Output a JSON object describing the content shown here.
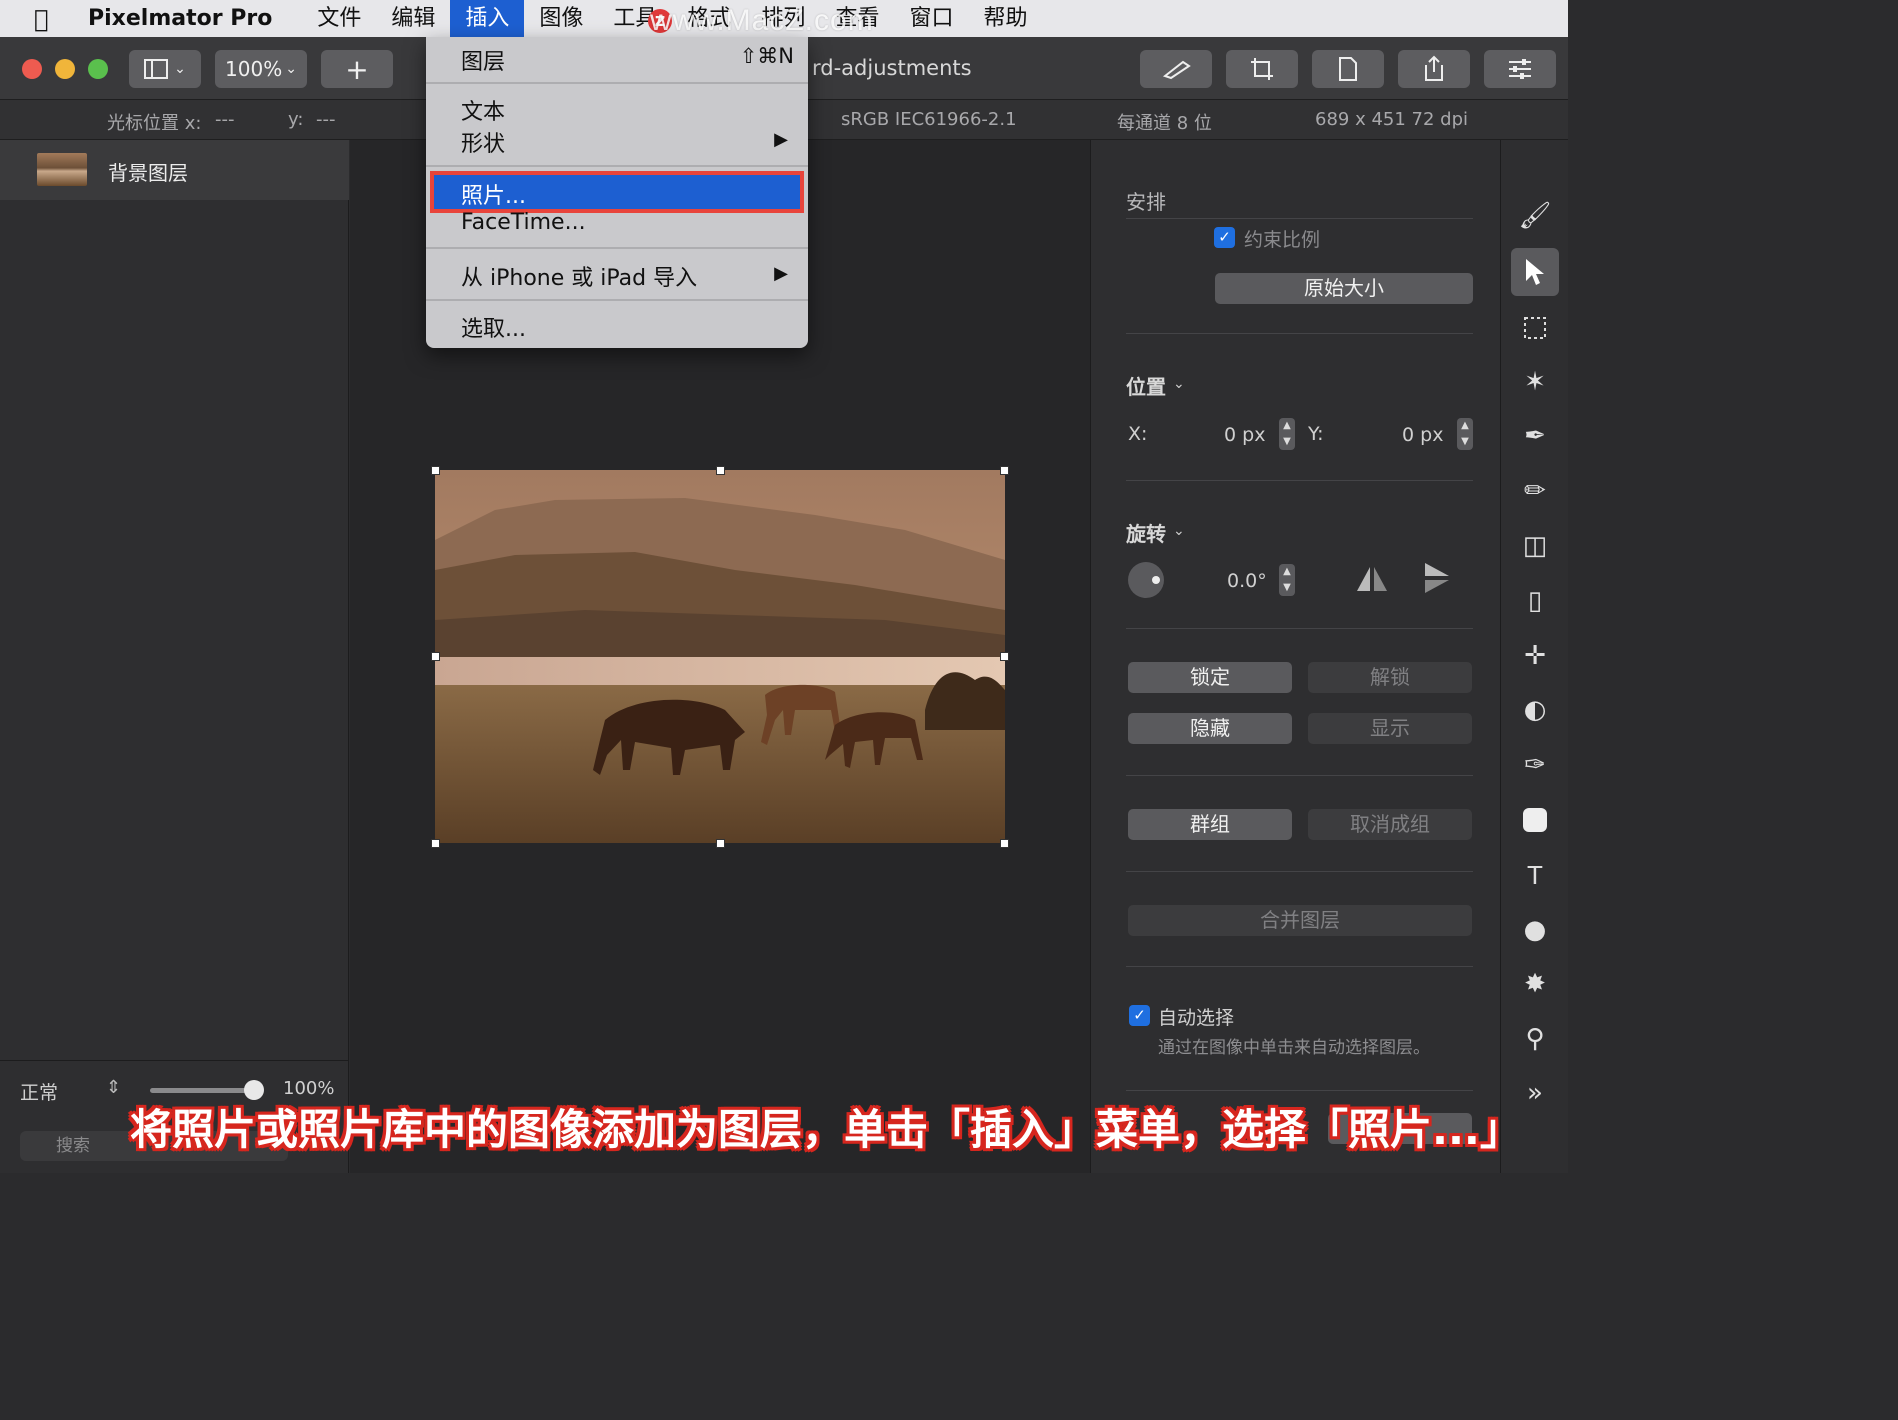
{
  "menubar": {
    "app_name": "Pixelmator Pro",
    "items": [
      "文件",
      "编辑",
      "插入",
      "图像",
      "工具",
      "格式",
      "排列",
      "查看",
      "窗口",
      "帮助"
    ],
    "active_item": "插入"
  },
  "watermark": "www.MacZ.com",
  "toolbar": {
    "zoom": "100%",
    "doc_title": "rd-adjustments"
  },
  "infobar": {
    "cursor_x_label": "光标位置 x:",
    "cursor_x_value": "---",
    "cursor_y_label": "y:",
    "cursor_y_value": "---",
    "color_profile": "sRGB IEC61966-2.1",
    "bit_depth": "每通道 8 位",
    "dimensions": "689 x 451 72 dpi"
  },
  "sidebar": {
    "layer_name": "背景图层",
    "blend_mode": "正常",
    "opacity": "100%",
    "search_placeholder": "搜索"
  },
  "insert_menu": {
    "items": [
      {
        "label": "图层",
        "shortcut": "⇧⌘N"
      },
      {
        "label": "文本"
      },
      {
        "label": "形状",
        "submenu": true
      },
      {
        "label": "照片...",
        "highlighted": true
      },
      {
        "label": "FaceTime..."
      },
      {
        "label": "从 iPhone 或 iPad 导入",
        "submenu": true
      },
      {
        "label": "选取..."
      }
    ]
  },
  "inspector": {
    "arrange_title": "安排",
    "constrain_label": "约束比例",
    "original_size_btn": "原始大小",
    "position_title": "位置",
    "x_label": "X:",
    "x_value": "0 px",
    "y_label": "Y:",
    "y_value": "0 px",
    "rotation_title": "旋转",
    "rotation_value": "0.0°",
    "lock_btn": "锁定",
    "unlock_btn": "解锁",
    "hide_btn": "隐藏",
    "show_btn": "显示",
    "group_btn": "群组",
    "ungroup_btn": "取消成组",
    "merge_btn": "合并图层",
    "auto_select_label": "自动选择",
    "auto_select_desc": "通过在图像中单击来自动选择图层。"
  },
  "caption": "将照片或照片库中的图像添加为图层，单击「插入」菜单，选择「照片...」",
  "colors": {
    "menu_highlight": "#1d5fd1",
    "annotation_red": "#e8443b",
    "checkbox_blue": "#1f6fe0"
  }
}
